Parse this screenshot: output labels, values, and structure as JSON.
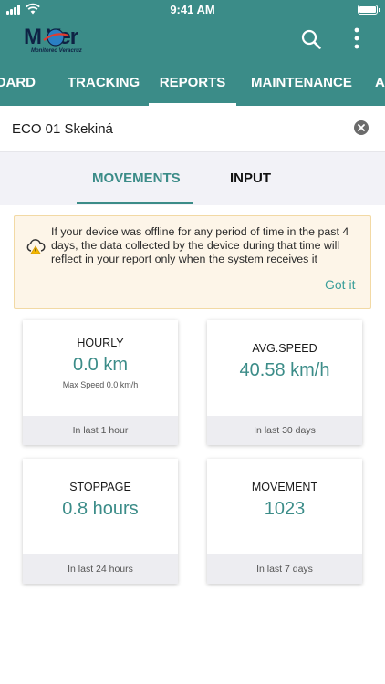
{
  "status_bar": {
    "time": "9:41 AM"
  },
  "header": {
    "logo_text": "M  Ver",
    "logo_subtitle": "Monitoreo Veracruz",
    "search_icon": "search-icon",
    "more_icon": "more-vertical-icon",
    "tabs": [
      {
        "label": "BOARD",
        "active": false
      },
      {
        "label": "TRACKING",
        "active": false
      },
      {
        "label": "REPORTS",
        "active": true
      },
      {
        "label": "MAINTENANCE",
        "active": false
      },
      {
        "label": "A",
        "active": false
      }
    ]
  },
  "device": {
    "name": "ECO 01 Skekiná",
    "clear_icon": "close-circle-icon"
  },
  "subtabs": [
    {
      "label": "MOVEMENTS",
      "active": true,
      "color": "#3b8c88"
    },
    {
      "label": "INPUT",
      "active": false,
      "color": "#111111"
    }
  ],
  "notice": {
    "icon": "cloud-warning-icon",
    "text": "If your device was offline for any period of time in the past 4 days, the data collected by the device during that time will reflect in your report only when the system receives it",
    "action_label": "Got it"
  },
  "cards": [
    {
      "label": "HOURLY",
      "value": "0.0 km",
      "sub": "Max Speed 0.0 km/h",
      "footer": "In last 1 hour"
    },
    {
      "label": "AVG.SPEED",
      "value": "40.58 km/h",
      "sub": "",
      "footer": "In last 30 days"
    },
    {
      "label": "STOPPAGE",
      "value": "0.8 hours",
      "sub": "",
      "footer": "In last 24 hours"
    },
    {
      "label": "MOVEMENT",
      "value": "1023",
      "sub": "",
      "footer": "In last 7 days"
    }
  ],
  "colors": {
    "header": "#3b8c88",
    "accent": "#3b9f9a",
    "notice_bg": "#fdf5e8"
  }
}
